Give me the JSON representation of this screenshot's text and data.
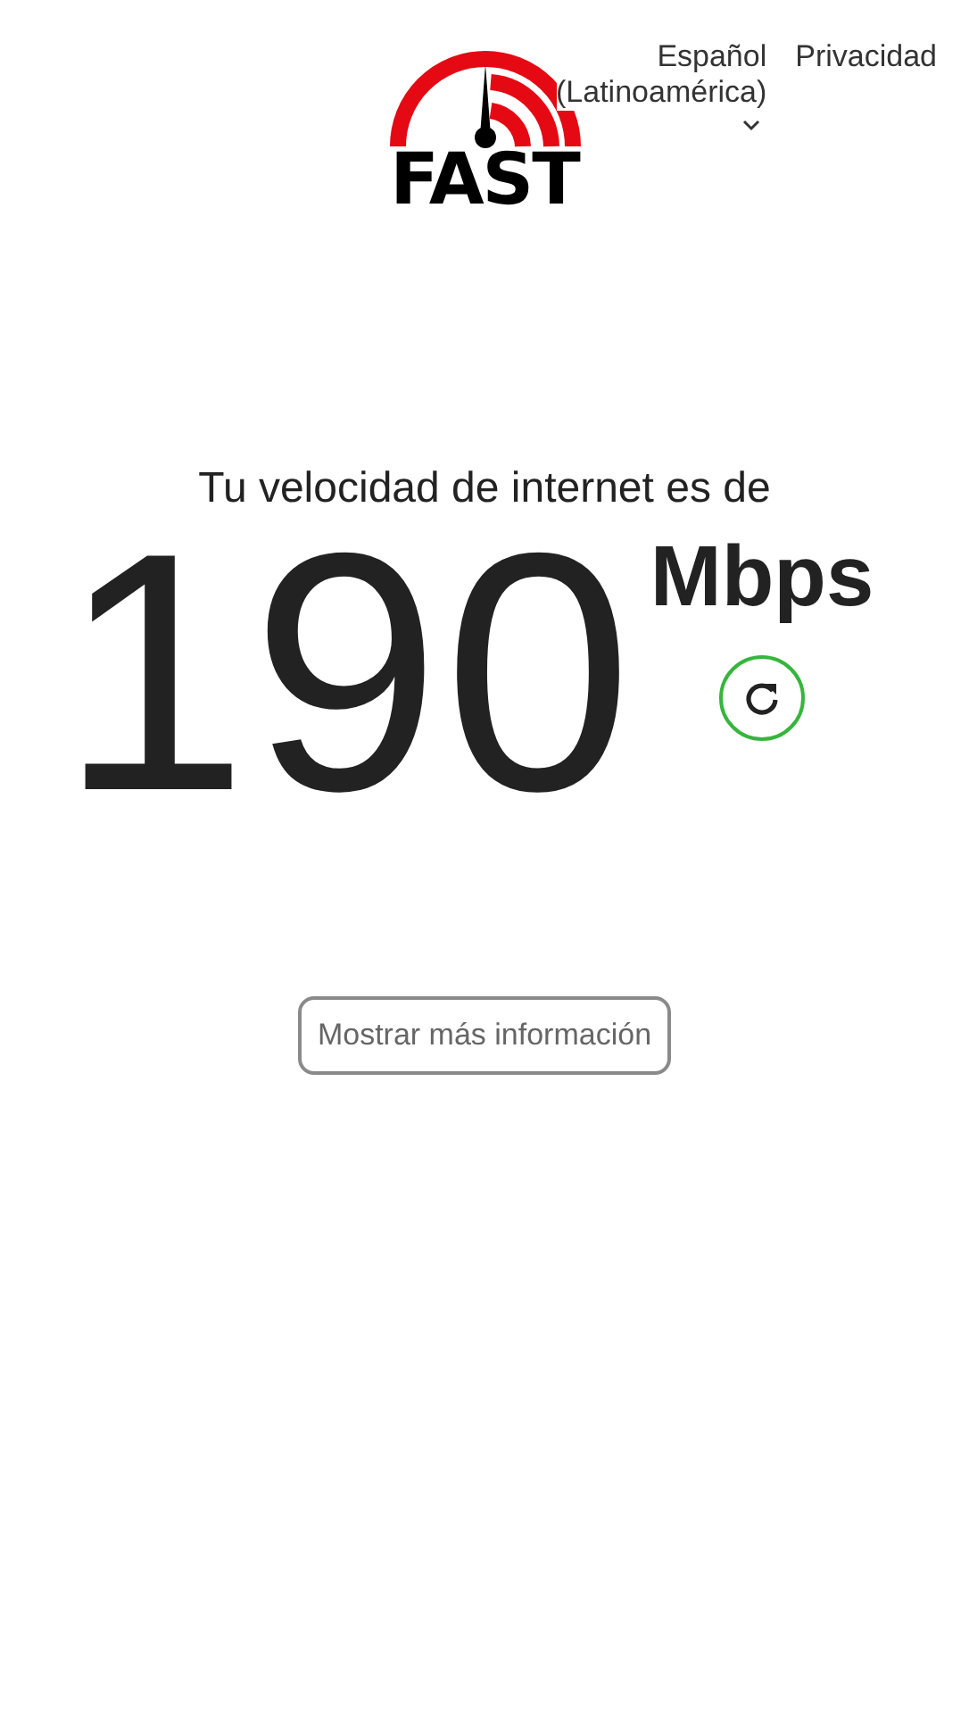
{
  "logo": {
    "wordmark": "FAST"
  },
  "nav": {
    "language": {
      "label": "Español",
      "region": "(Latinoamérica)"
    },
    "privacy": "Privacidad"
  },
  "result": {
    "heading": "Tu velocidad de internet es de",
    "speed": "190",
    "unit": "Mbps"
  },
  "more_info_button": "Mostrar más información"
}
